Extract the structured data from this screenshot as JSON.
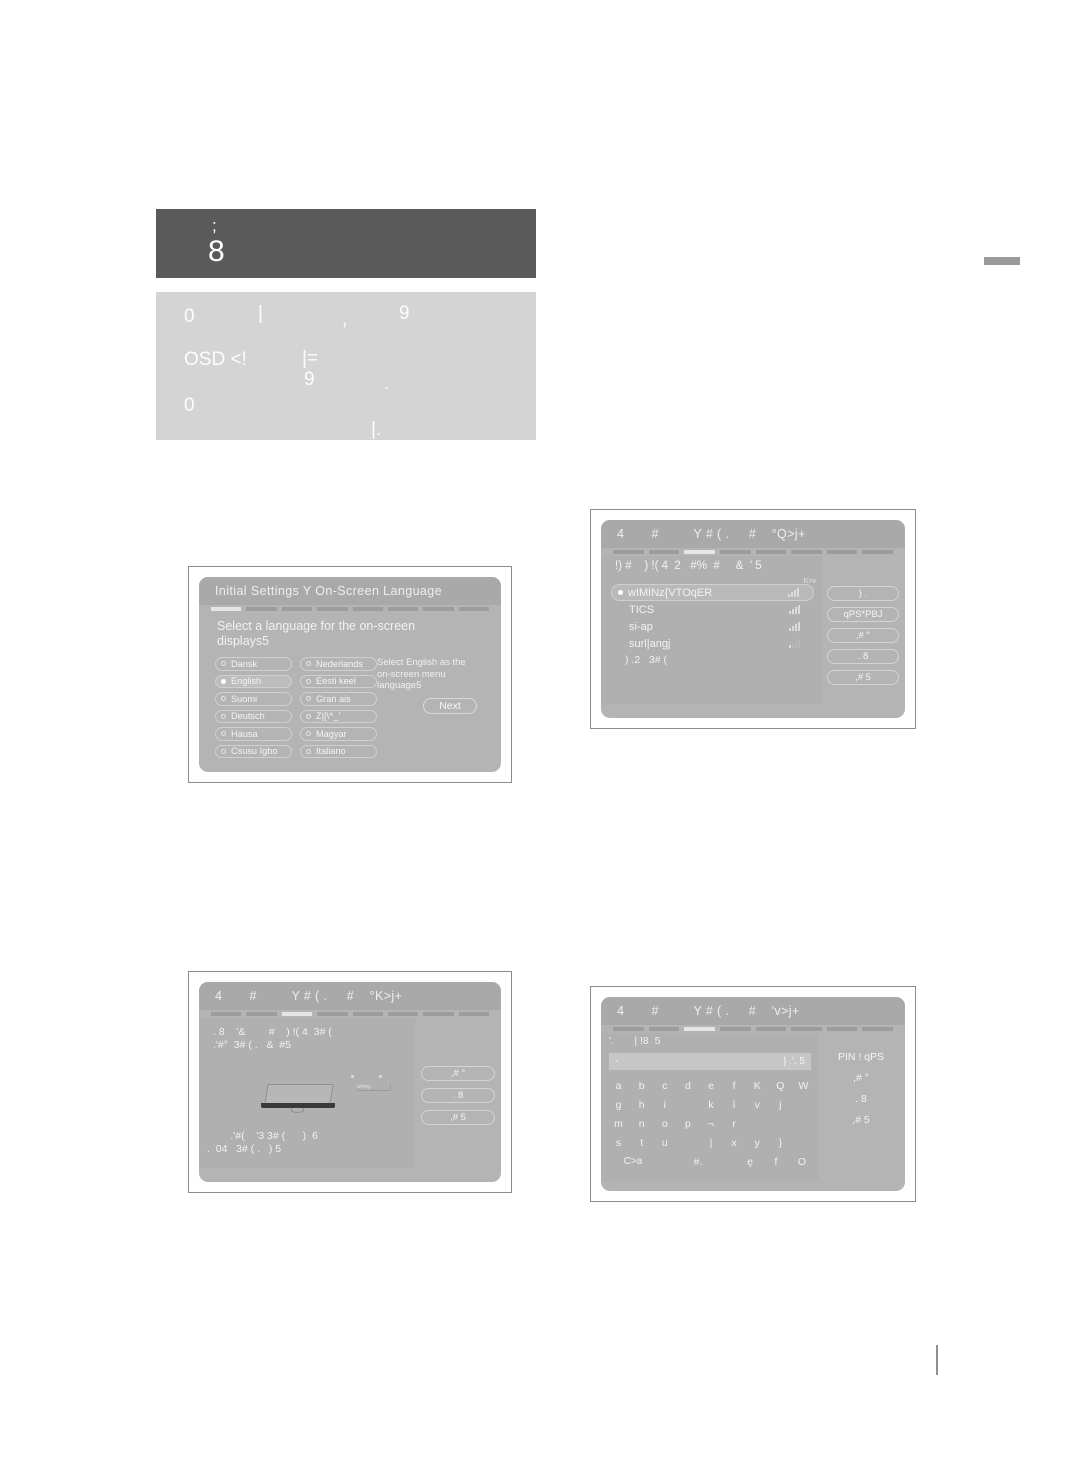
{
  "header": {
    "dark_block": {
      "line1": ";",
      "line2": "8"
    },
    "light_block": {
      "a": "0",
      "b": "|",
      "c": ",",
      "d": "9",
      "e": ".",
      "f": "OSD <!",
      "g": "|=",
      "h": "9",
      "i": ".",
      "j": "0",
      "k": "|."
    }
  },
  "language_screen": {
    "title": "Initial Settings Y On-Screen Language",
    "steps_total": 8,
    "step_active_index": 0,
    "prompt": "Select a language for the on-screen displays5",
    "note": "Select English as  the on-screen menu language5",
    "next_label": "Next",
    "selected": "English",
    "column_left": [
      "Dansk",
      "English",
      "Suomi",
      "Deutsch",
      "Hausa",
      "Csusu Igbo"
    ],
    "column_right": [
      "Nederlands",
      "Eesti keel",
      "Gran ais",
      "Z|[\\^_'",
      "Magyar",
      "Italiano"
    ]
  },
  "wifi_screen": {
    "title": "4       #         Y # ( .     #    °Q>j+",
    "steps_total": 8,
    "step_active_index": 2,
    "heading": "!) #    ) !( 4  2   #%  #     &  ' 5",
    "refresh_label": "K>v",
    "networks": [
      {
        "name": "wIMINz{VTOqER",
        "strength": 4,
        "selected": true
      },
      {
        "name": "TICS",
        "strength": 4,
        "selected": false
      },
      {
        "name": "si-ap",
        "strength": 4,
        "selected": false
      },
      {
        "name": "surl|angj",
        "strength": 1,
        "selected": false
      }
    ],
    "more_label": ") .2   3# (",
    "buttons": [
      ") .",
      "qPS*PBJ",
      ",#   °",
      ". 8",
      ",#  5"
    ]
  },
  "device_screen": {
    "title": "4       #         Y # ( .     #    °K>j+",
    "steps_total": 8,
    "step_active_index": 2,
    "text_top": ". 8    '&        #    ) !( 4  3# (\n.'#°  3# ( .   &  #5",
    "text_bottom": "        .'#(    '3 3# (      )  6\n.  04   3# ( .   ) 5",
    "hint_tag": "wiring",
    "buttons": [
      ",#   °",
      ". 8",
      ",#  5"
    ]
  },
  "keyboard_screen": {
    "title": "4       #         Y # ( .     #    'v>j+",
    "steps_total": 8,
    "step_active_index": 2,
    "label": "'.       | !8  5",
    "field_value": "-",
    "field_hint": "} .'. 5",
    "rows": [
      [
        "a",
        "b",
        "c",
        "d",
        "e",
        "f",
        "K",
        "Q",
        "W"
      ],
      [
        "g",
        "h",
        "i",
        "",
        "k",
        "l",
        "v",
        "j",
        ""
      ],
      [
        "m",
        "n",
        "o",
        "p",
        "¬",
        "r",
        "",
        "",
        ""
      ],
      [
        "s",
        "t",
        "u",
        "",
        "|",
        "x",
        "y",
        "}",
        ""
      ],
      [
        "C>a",
        "",
        "#.",
        "",
        "ę",
        "f",
        "O"
      ]
    ],
    "side": [
      "PIN ! qPS",
      ",#   °",
      ". 8",
      ",#  5"
    ]
  }
}
